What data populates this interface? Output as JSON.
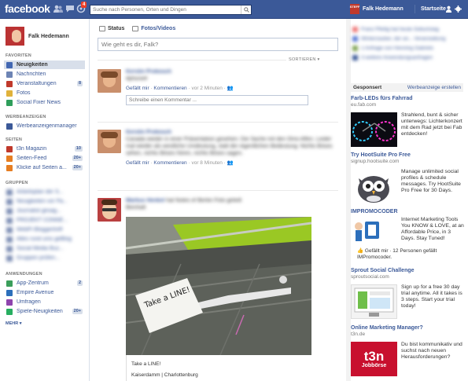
{
  "topbar": {
    "logo": "facebook",
    "search_placeholder": "Suche nach Personen, Orten und Dingen",
    "notifications_count": "4",
    "profile_avatar_text": "STEFF",
    "profile_name": "Falk Hedemann",
    "home_label": "Startseite"
  },
  "sidebar": {
    "profile_name": "Falk Hedemann",
    "favorites_title": "FAVORITEN",
    "favorites": [
      {
        "label": "Neuigkeiten",
        "count": "",
        "color": "#4267b2"
      },
      {
        "label": "Nachrichten",
        "count": "",
        "color": "#6d84b4"
      },
      {
        "label": "Veranstaltungen",
        "count": "8",
        "color": "#c0392b"
      },
      {
        "label": "Fotos",
        "count": "",
        "color": "#e0b23b"
      },
      {
        "label": "Social Fixer News",
        "count": "",
        "color": "#2f9e5b"
      }
    ],
    "ads_title": "WERBEANZEIGEN",
    "ads": [
      {
        "label": "Werbeanzeigenmanager",
        "color": "#3b5998"
      }
    ],
    "pages_title": "SEITEN",
    "pages": [
      {
        "label": "t3n Magazin",
        "count": "10",
        "color": "#c0392b"
      },
      {
        "label": "Seiten-Feed",
        "count": "20+",
        "color": "#e67e22"
      },
      {
        "label": "Klicke auf Seiten a...",
        "count": "20+",
        "color": "#e67e22"
      }
    ],
    "groups_title": "GRUPPEN",
    "groups": [
      {
        "label": "Arbeitsplan der S...",
        "count": "",
        "color": "#7f8fb5"
      },
      {
        "label": "Neuigkeiten vor Pa...",
        "count": "",
        "color": "#7f8fb5"
      },
      {
        "label": "Journalist gesag...",
        "count": "",
        "color": "#7f8fb5"
      },
      {
        "label": "PROJEKT CONNE...",
        "count": "",
        "color": "#7f8fb5"
      },
      {
        "label": "WebPi Bloggertreff",
        "count": "",
        "color": "#7f8fb5"
      },
      {
        "label": "Alles rund ums geBlog",
        "count": "",
        "color": "#7f8fb5"
      },
      {
        "label": "Social Media Buz...",
        "count": "",
        "color": "#7f8fb5"
      },
      {
        "label": "Gruppen prüfen...",
        "count": "",
        "color": "#7f8fb5"
      }
    ],
    "apps_title": "ANWENDUNGEN",
    "apps": [
      {
        "label": "App-Zentrum",
        "count": "2",
        "color": "#3b9e5b"
      },
      {
        "label": "Empire Avenue",
        "count": "",
        "color": "#2c6fbb"
      },
      {
        "label": "Umfragen",
        "count": "",
        "color": "#8e44ad"
      },
      {
        "label": "Spiele-Neuigkeiten",
        "count": "20+",
        "color": "#27ae60"
      }
    ],
    "more_label": "MEHR ▾"
  },
  "composer": {
    "tab_status": "Status",
    "tab_photo": "Fotos/Videos",
    "placeholder": "Wie geht es dir, Falk?",
    "sort_label": "SORTIEREN ▾"
  },
  "stories": [
    {
      "author": "Kerstin Prokosch",
      "text": "#phone#",
      "like": "Gefällt mir",
      "comment": "Kommentieren",
      "time": "vor 2 Minuten",
      "comment_placeholder": "Schreibe einen Kommentar ..."
    },
    {
      "author": "Kerstin Prokosch",
      "text": "Canada wieder in einer Präsentation gesehen: Die Sache mit den Omo Affen. Leider mal wieder als westliche Umdeutung, statt der eigentlichen Bedeutung: Nichts Böses sehen, nichts Böses hören, nichts Böses sagen.",
      "like": "Gefällt mir",
      "comment": "Kommentieren",
      "time": "vor 8 Minuten"
    },
    {
      "author": "Markus Henkel",
      "author_suffix": "hat Notes of Berliin Foto geteilt",
      "subtitle": "Beinhalt",
      "caption": "Take a LINE!",
      "location": "Kaiserdamm | Charlottenburg",
      "photo_text": "Take a LINE!"
    }
  ],
  "rightcol": {
    "upcoming": [
      "Franz Pfeilig hat heute Geburtstag",
      "Winterzauber, der an... Veranstaltung",
      "1 Anfrage von Henning Gabriels",
      "3 weitere Anwendungsanfragen"
    ],
    "sponsored_label": "Gesponsert",
    "create_ad_label": "Werbeanzeige erstellen",
    "ads": [
      {
        "title": "Farb-LEDs fürs Fahrrad",
        "domain": "eu.fab.com",
        "text": "Strahlend, bunt & sicher unterwegs: Lichterkonzert mit dem Rad jetzt bei Fab entdecken!"
      },
      {
        "title": "Try HootSuite Pro Free",
        "domain": "signup.hootsuite.com",
        "text": "Manage unlimited social profiles & schedule messages. Try HootSuite Pro Free for 30 Days."
      },
      {
        "title": "IMPROMOCODER",
        "domain": "",
        "text": "Internet Marketing Tools You KNOW & LOVE, at an Affordable Price, in 3 Days. Stay Tuned!",
        "like_text": "Gefällt mir · 12 Personen gefällt IMPromocoder."
      },
      {
        "title": "Sprout Social Challenge",
        "domain": "sproutsocial.com",
        "text": "Sign up for a free 30 day trial anytime. All it takes is 3 steps. Start your trial today!"
      },
      {
        "title": "Online Marketing Manager?",
        "domain": "t3n.de",
        "text": "Du bist kommunikativ und suchst nach neuen Herausforderungen?",
        "logo_big": "t3n",
        "logo_small": "Jobbörse"
      }
    ]
  }
}
